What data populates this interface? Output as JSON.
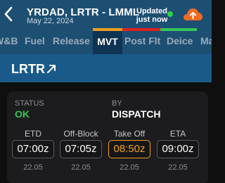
{
  "header": {
    "title": "YRDAD, LRTR - LMML",
    "date": "May 22, 2024",
    "updated_label": "Updated just now",
    "status_color": "#2bd14a"
  },
  "tabs": [
    {
      "label": "W&B",
      "bar_color": "#1d4f73"
    },
    {
      "label": "Fuel",
      "bar_color": "#1d4f73"
    },
    {
      "label": "Release",
      "bar_color": "#1d4f73"
    },
    {
      "label": "MVT",
      "bar_color": "#f0a020",
      "active": true
    },
    {
      "label": "Post Flt",
      "bar_color": "#e02020"
    },
    {
      "label": "Deice",
      "bar_color": "#35c759"
    },
    {
      "label": "Ma",
      "bar_color": "#1d4f73"
    }
  ],
  "section": {
    "title": "LRTR",
    "icon": "arrow-up-right-icon"
  },
  "card": {
    "status_label": "STATUS",
    "status_value": "OK",
    "by_label": "BY",
    "by_value": "DISPATCH",
    "times": [
      {
        "label": "ETD",
        "value": "07:00z",
        "date": "22.05"
      },
      {
        "label": "Off-Block",
        "value": "07:05z",
        "date": "22.05"
      },
      {
        "label": "Take Off",
        "value": "08:50z",
        "date": "22.05",
        "highlight": true
      },
      {
        "label": "ETA",
        "value": "09:00z",
        "date": "22.05"
      }
    ]
  }
}
